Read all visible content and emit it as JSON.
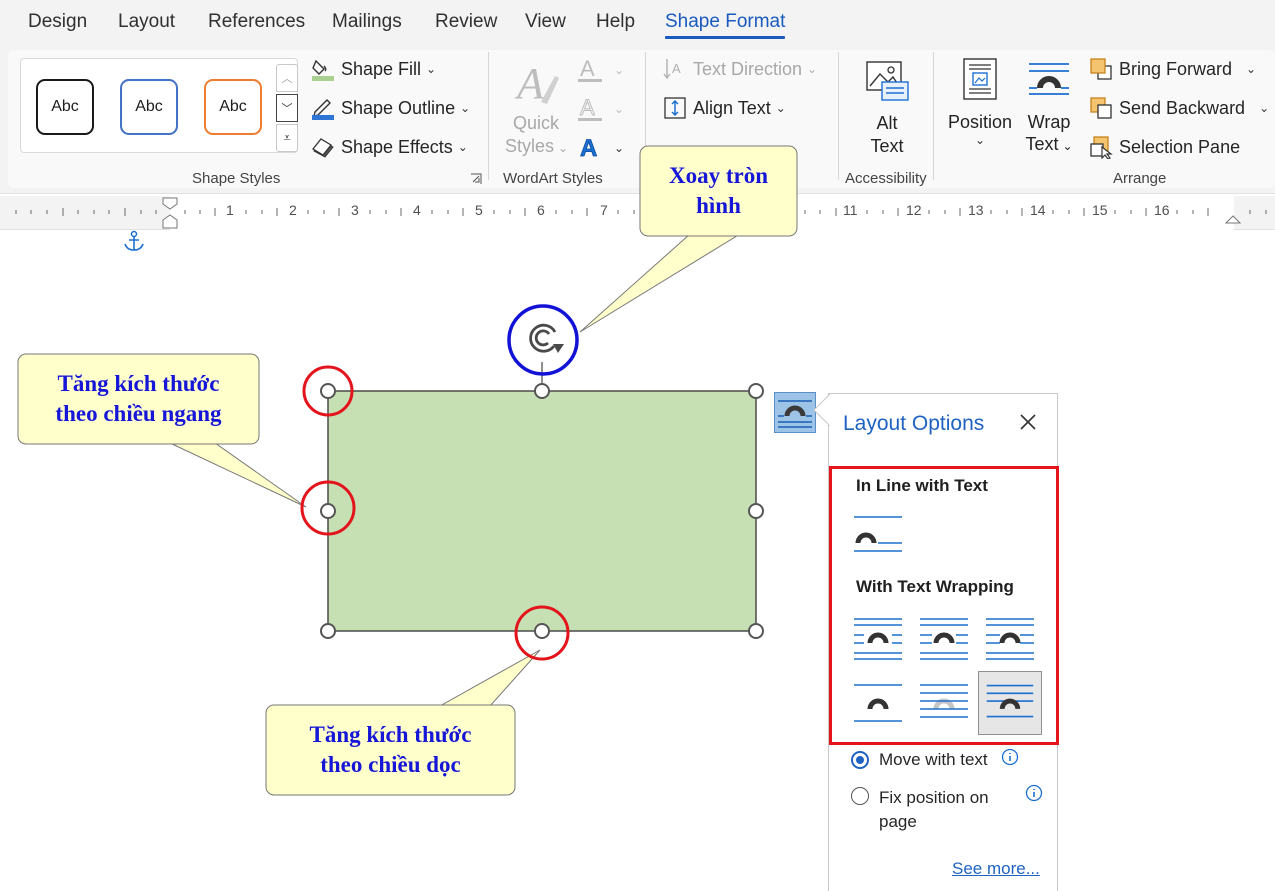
{
  "tabs": [
    "Design",
    "Layout",
    "References",
    "Mailings",
    "Review",
    "View",
    "Help",
    "Shape Format"
  ],
  "ribbon": {
    "shape_styles": {
      "gallery": [
        "Abc",
        "Abc",
        "Abc"
      ],
      "fill": "Shape Fill",
      "outline": "Shape Outline",
      "effects": "Shape Effects",
      "label": "Shape Styles"
    },
    "wordart": {
      "quick_styles_line1": "Quick",
      "quick_styles_line2": "Styles",
      "label": "WordArt Styles"
    },
    "text": {
      "direction": "Text Direction",
      "align": "Align Text"
    },
    "accessibility": {
      "alt_line1": "Alt",
      "alt_line2": "Text",
      "label": "Accessibility"
    },
    "arrange": {
      "position": "Position",
      "wrap_line1": "Wrap",
      "wrap_line2": "Text",
      "bring_forward": "Bring Forward",
      "send_backward": "Send Backward",
      "selection_pane": "Selection Pane",
      "label": "Arrange"
    }
  },
  "ruler": [
    "1",
    "2",
    "3",
    "4",
    "5",
    "6",
    "7",
    "11",
    "12",
    "13",
    "14",
    "15",
    "16"
  ],
  "callouts": {
    "rotate_line1": "Xoay tròn",
    "rotate_line2": "hình",
    "horizontal_line1": "Tăng kích thước",
    "horizontal_line2": "theo chiều ngang",
    "vertical_line1": "Tăng kích thước",
    "vertical_line2": "theo chiều dọc"
  },
  "layout_options": {
    "title": "Layout Options",
    "inline_heading": "In Line with Text",
    "wrapping_heading": "With Text Wrapping",
    "move_with_text": "Move with text",
    "fix_position": "Fix position on page",
    "see_more": "See more..."
  },
  "colors": {
    "accent": "#185abd",
    "shape_fill": "#c6e0b4",
    "callout_fill": "#ffffcc",
    "callout_text": "#1616d8",
    "highlight_red": "#e3141b",
    "rotate_circle": "#1212d6"
  }
}
